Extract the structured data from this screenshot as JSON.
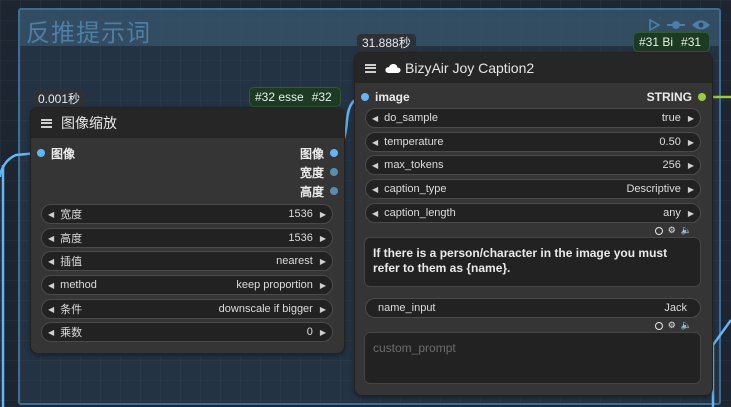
{
  "group": {
    "title": "反推提示词"
  },
  "resize_node": {
    "time": "0.001秒",
    "id_badge_text": "#32 esse",
    "id": "#32",
    "title": "图像缩放",
    "input": "图像",
    "outputs": [
      "图像",
      "宽度",
      "高度"
    ],
    "widgets": [
      {
        "label": "宽度",
        "value": "1536"
      },
      {
        "label": "高度",
        "value": "1536"
      },
      {
        "label": "插值",
        "value": "nearest"
      },
      {
        "label": "method",
        "value": "keep proportion"
      },
      {
        "label": "条件",
        "value": "downscale if bigger"
      },
      {
        "label": "乘数",
        "value": "0"
      }
    ]
  },
  "caption_node": {
    "time": "31.888秒",
    "id_badge_text": "#31 Bi",
    "id": "#31",
    "title": "BizyAir Joy Caption2",
    "input": "image",
    "output": "STRING",
    "widgets": [
      {
        "label": "do_sample",
        "value": "true"
      },
      {
        "label": "temperature",
        "value": "0.50"
      },
      {
        "label": "max_tokens",
        "value": "256"
      },
      {
        "label": "caption_type",
        "value": "Descriptive"
      },
      {
        "label": "caption_length",
        "value": "any"
      }
    ],
    "extra_options_text": "If there is a person/character in the image you must refer to them as {name}.",
    "name_input": {
      "label": "name_input",
      "value": "Jack"
    },
    "custom_prompt_placeholder": "custom_prompt"
  },
  "colors": {
    "wire_image": "#64b5f6",
    "wire_string": "#9ccc3a",
    "group_border": "#3d6d92"
  }
}
